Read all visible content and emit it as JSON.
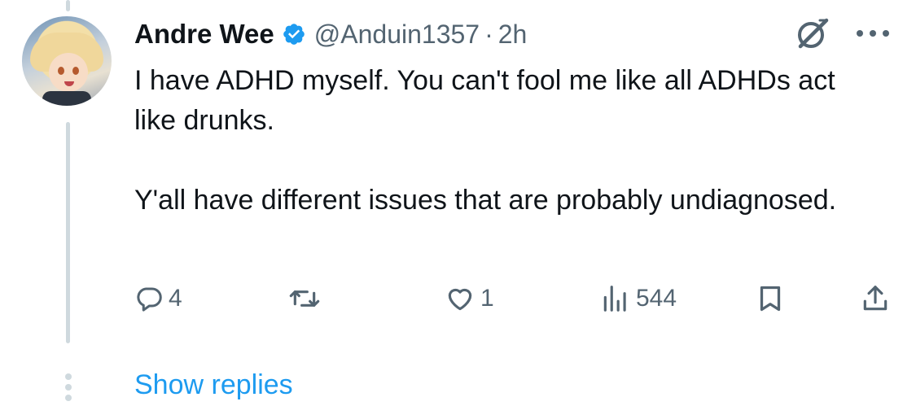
{
  "tweet": {
    "author_name": "Andre Wee",
    "handle": "@Anduin1357",
    "separator": "·",
    "time": "2h",
    "paragraphs": [
      "I have ADHD myself. You can't fool me like all ADHDs act like drunks.",
      "Y'all have different issues that are probably undiagnosed."
    ],
    "verified": true
  },
  "actions": {
    "replies": "4",
    "reposts": "",
    "likes": "1",
    "views": "544"
  },
  "icons": {
    "verified": "verified-badge-icon",
    "grok": "grok-icon",
    "more": "more-horizontal-icon",
    "reply": "reply-icon",
    "repost": "repost-icon",
    "like": "heart-icon",
    "views": "views-chart-icon",
    "bookmark": "bookmark-icon",
    "share": "share-icon",
    "thread_more": "more-vertical-icon"
  },
  "show_replies_label": "Show replies",
  "colors": {
    "text": "#0f1419",
    "secondary": "#536471",
    "accent": "#1d9bf0",
    "thread_line": "#cfd9de"
  }
}
